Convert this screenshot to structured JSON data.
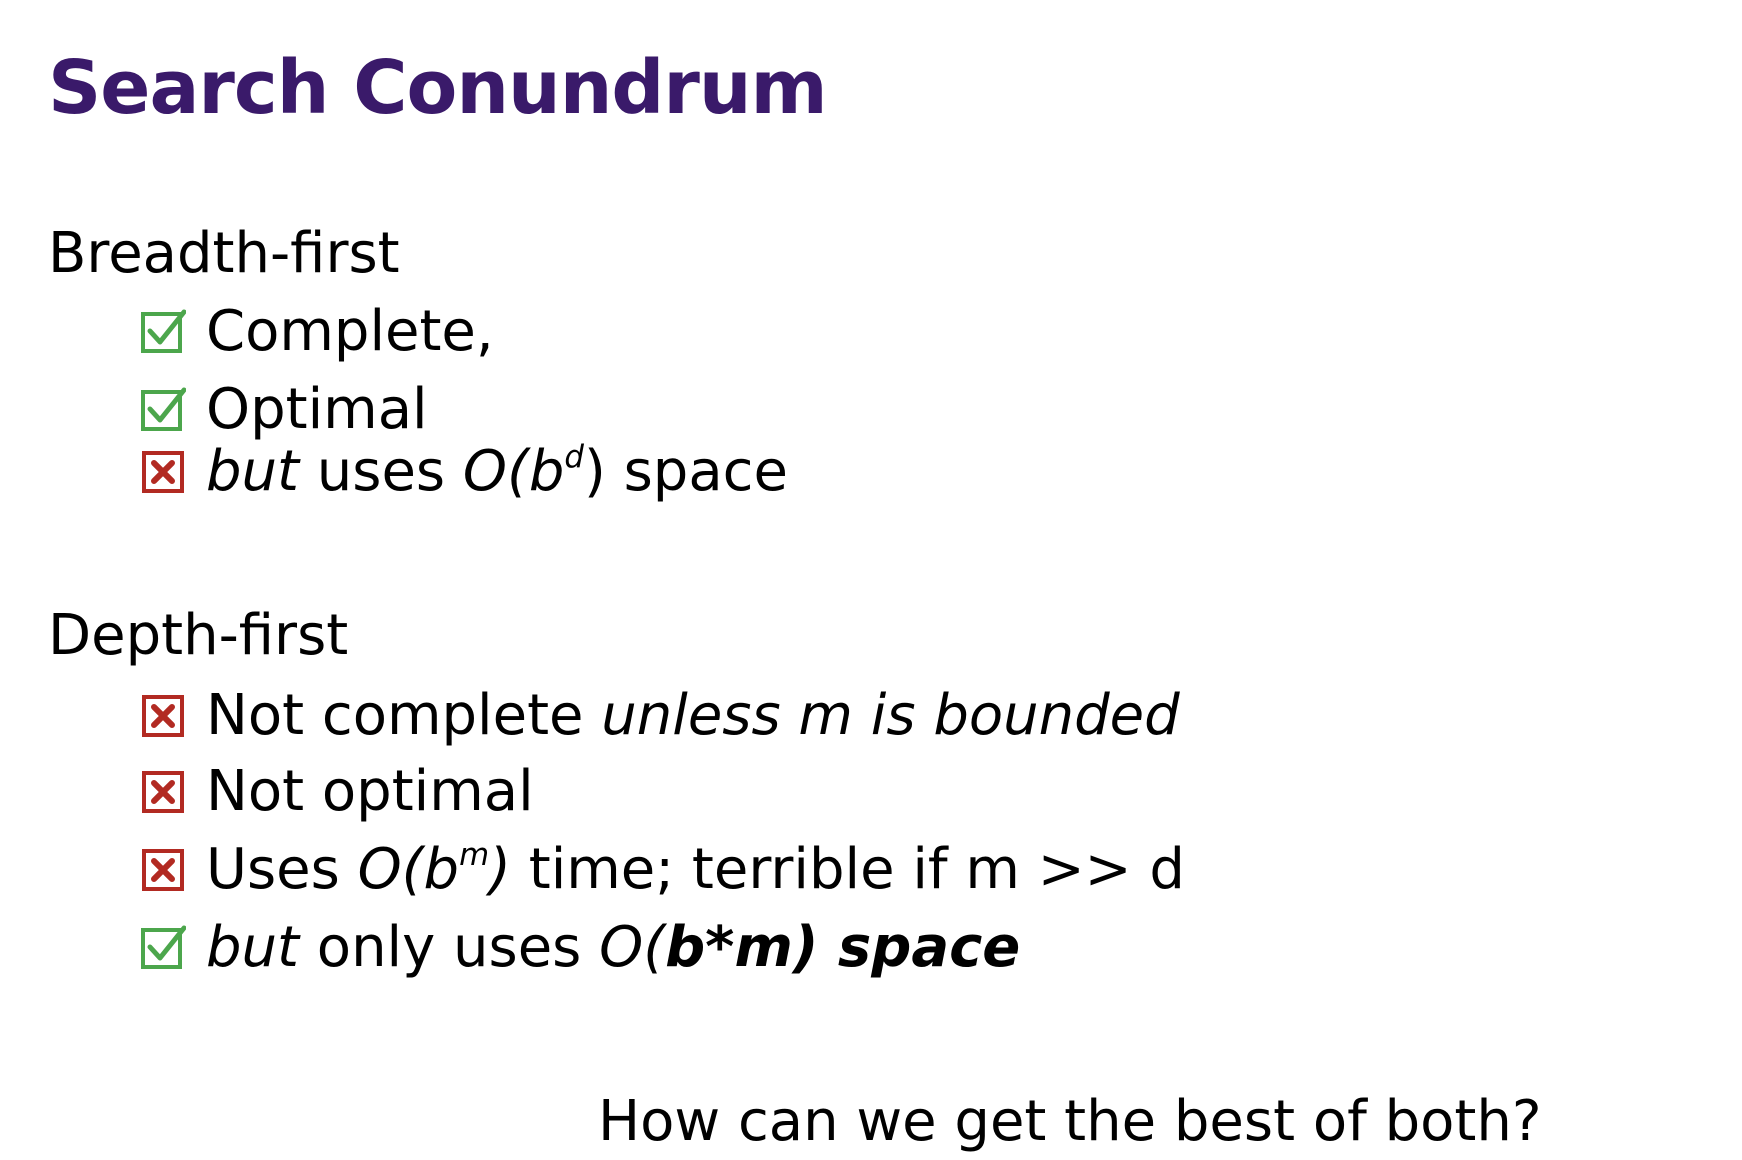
{
  "colors": {
    "title": "#3a1a6a",
    "text": "#000000",
    "check": "#4ca64c",
    "cross": "#b22a22"
  },
  "title": "Search Conundrum",
  "breadth": {
    "heading": "Breadth-first",
    "items": [
      {
        "icon": "checkbox-checked-icon",
        "parts": [
          "Complete,"
        ]
      },
      {
        "icon": "checkbox-checked-icon",
        "parts": [
          "Optimal"
        ]
      },
      {
        "icon": "checkbox-crossed-icon",
        "parts": [
          "but",
          " uses ",
          "O(b",
          "d",
          ")",
          " space"
        ]
      }
    ]
  },
  "depth": {
    "heading": "Depth-first",
    "items": [
      {
        "icon": "checkbox-crossed-icon",
        "parts": [
          "Not complete ",
          "unless m is bounded"
        ]
      },
      {
        "icon": "checkbox-crossed-icon",
        "parts": [
          "Not optimal"
        ]
      },
      {
        "icon": "checkbox-crossed-icon",
        "parts": [
          "Uses ",
          "O(b",
          "m",
          ")",
          " time; terrible if m >> d"
        ]
      },
      {
        "icon": "checkbox-checked-icon",
        "parts": [
          "but",
          " only uses ",
          "O(",
          "b*m) space"
        ]
      }
    ]
  },
  "question": "How can we get the best of both?"
}
